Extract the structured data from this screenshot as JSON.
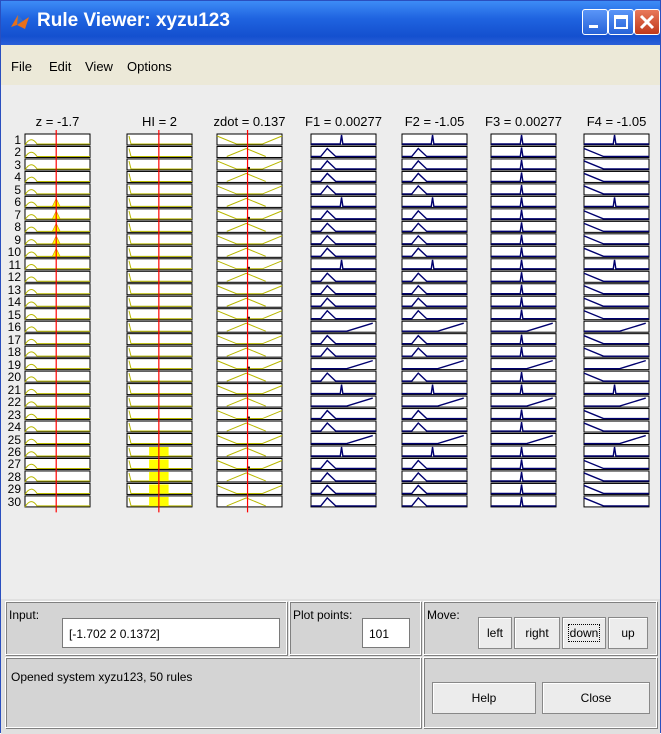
{
  "window": {
    "title": "Rule Viewer: xyzu123"
  },
  "menu": [
    "File",
    "Edit",
    "View",
    "Options"
  ],
  "variables": [
    {
      "label": "z = -1.7",
      "kind": "input"
    },
    {
      "label": "HI = 2",
      "kind": "input"
    },
    {
      "label": "zdot = 0.137",
      "kind": "input"
    },
    {
      "label": "F1 = 0.00277",
      "kind": "output"
    },
    {
      "label": "F2 = -1.05",
      "kind": "output"
    },
    {
      "label": "F3 = 0.00277",
      "kind": "output"
    },
    {
      "label": "F4 = -1.05",
      "kind": "output"
    }
  ],
  "rule_numbers": [
    "1",
    "2",
    "3",
    "4",
    "5",
    "6",
    "7",
    "8",
    "9",
    "10",
    "11",
    "12",
    "13",
    "14",
    "15",
    "16",
    "17",
    "18",
    "19",
    "20",
    "21",
    "22",
    "23",
    "24",
    "25",
    "26",
    "27",
    "28",
    "29",
    "30"
  ],
  "input_panel": {
    "label": "Input:",
    "value": "[-1.702 2 0.1372]"
  },
  "plot_points": {
    "label": "Plot points:",
    "value": "101"
  },
  "move": {
    "label": "Move:",
    "buttons": [
      "left",
      "right",
      "down",
      "up"
    ]
  },
  "status_text": "Opened system xyzu123, 50 rules",
  "actions": {
    "help": "Help",
    "close": "Close"
  },
  "colors": {
    "title_bar": "#1f63e0",
    "input_curve": "#b8b800",
    "input_fill": "#ffff00",
    "output_curve": "#00006e",
    "indicator_line": "#ff0000"
  }
}
